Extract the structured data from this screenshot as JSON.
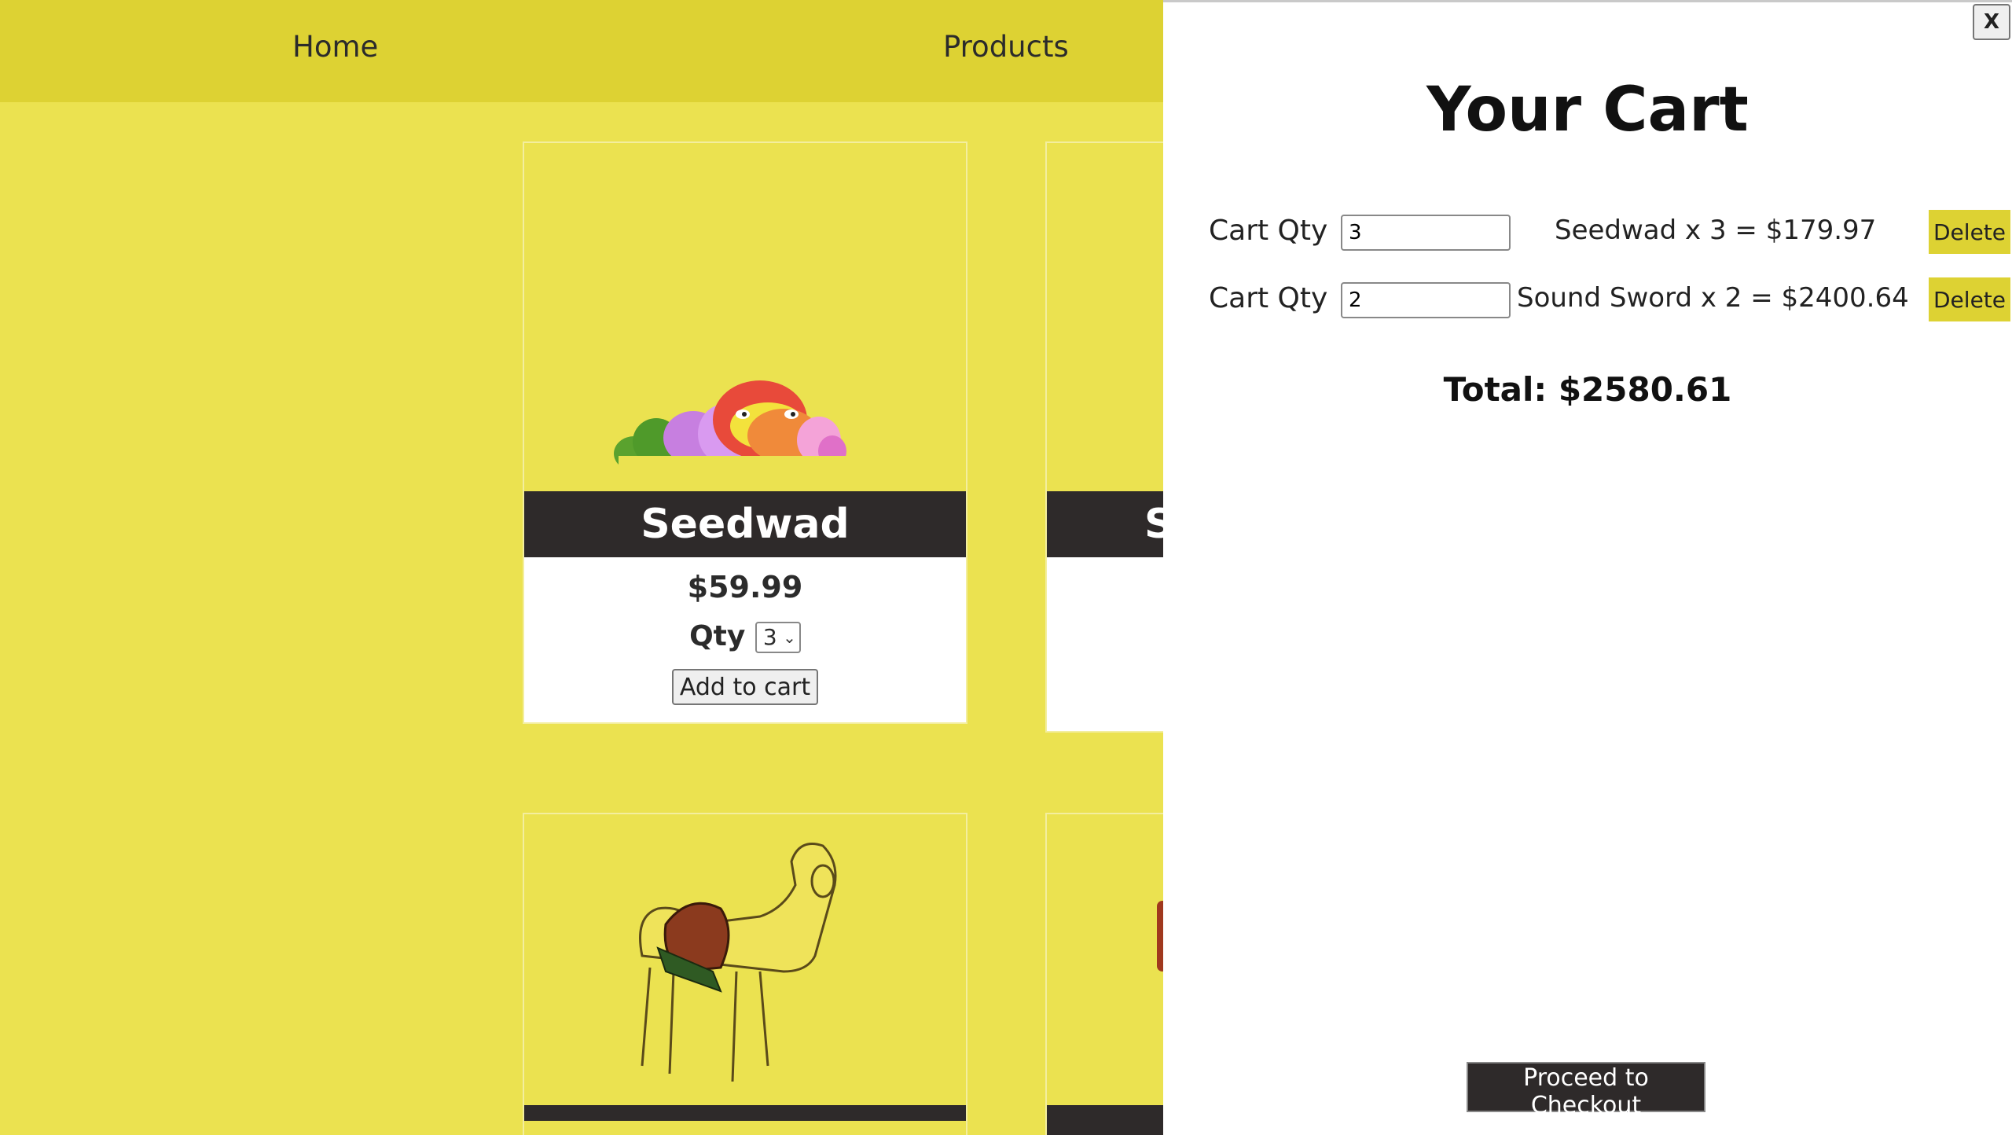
{
  "nav": {
    "home": "Home",
    "products": "Products"
  },
  "products": [
    {
      "title": "Seedwad",
      "price": "$59.99",
      "qty_label": "Qty",
      "qty_value": "3",
      "add_label": "Add to cart"
    },
    {
      "title": "S"
    }
  ],
  "cart": {
    "close_label": "X",
    "title": "Your Cart",
    "rows": [
      {
        "qty_label": "Cart Qty",
        "qty_value": "3",
        "line": "Seedwad x 3 = $179.97",
        "delete_label": "Delete"
      },
      {
        "qty_label": "Cart Qty",
        "qty_value": "2",
        "line": "Sound Sword x 2 = $2400.64",
        "delete_label": "Delete"
      }
    ],
    "total": "Total: $2580.61",
    "checkout_label": "Proceed to Checkout"
  },
  "colors": {
    "page_bg": "#ebe250",
    "nav_bg": "#ddd233",
    "title_bar": "#2e2a2a",
    "delete_btn": "#ddd233"
  }
}
